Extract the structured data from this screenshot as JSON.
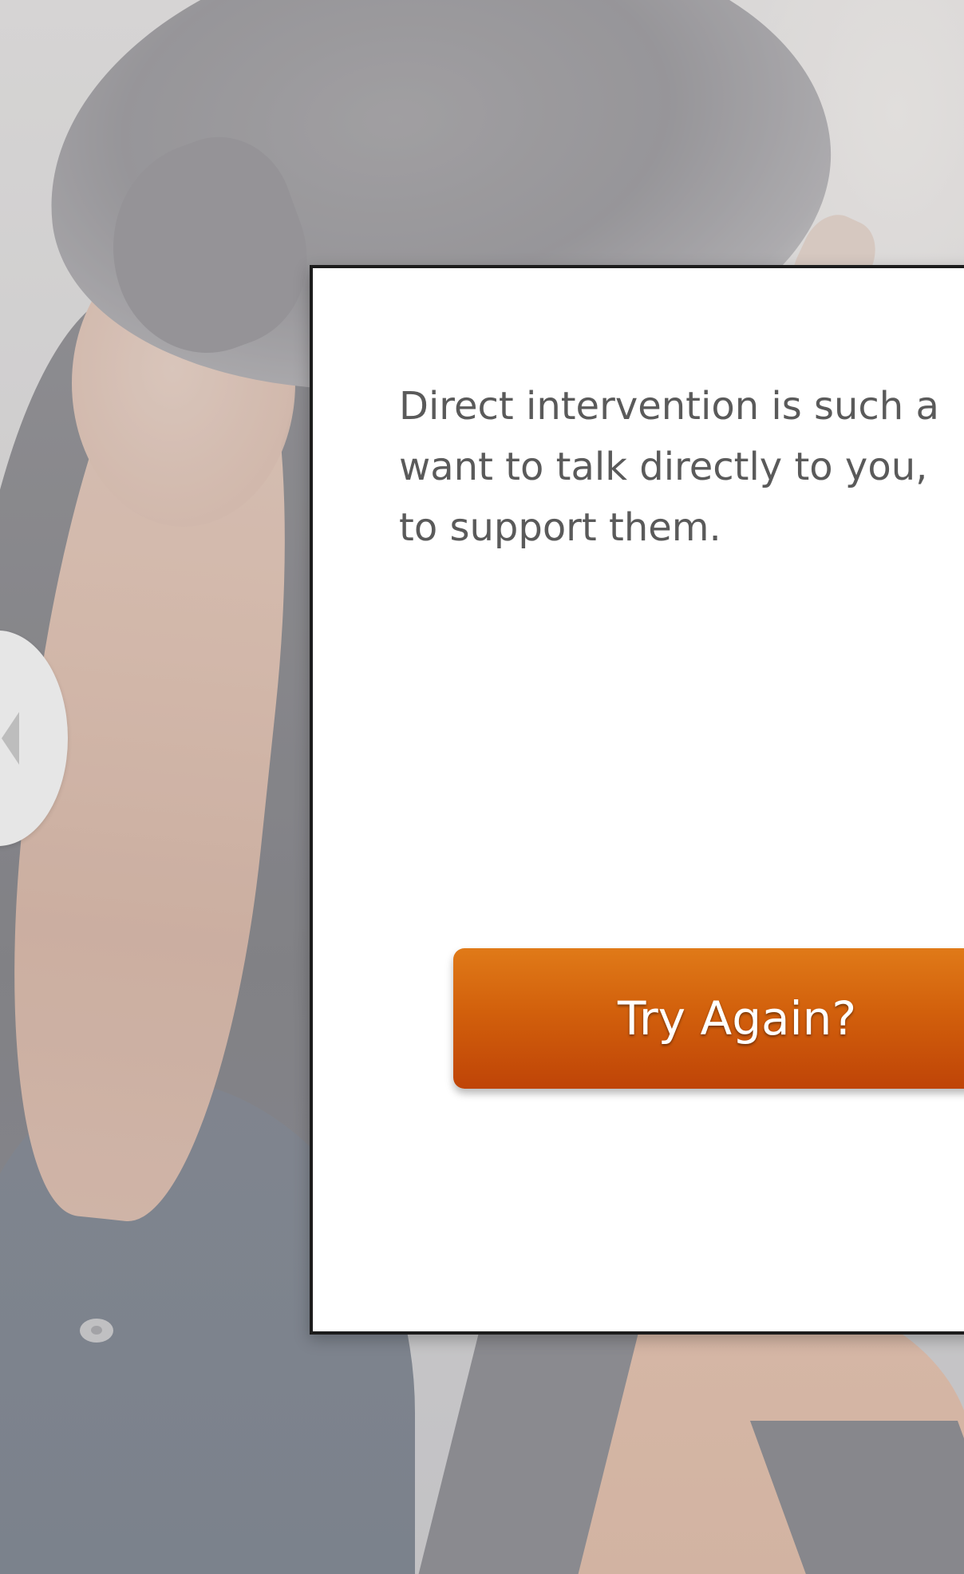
{
  "dialog": {
    "message": "Direct intervention is such a want to talk directly to you, to support them.",
    "lines": [
      "Direct intervention is such a",
      "want to talk directly to you,",
      "to support them."
    ],
    "retry_label": "Try Again?"
  },
  "navigation": {
    "back_icon": "chevron-left-icon"
  },
  "colors": {
    "button_top": "#e07a18",
    "button_bottom": "#bf4407",
    "dialog_border": "#1c1c1c",
    "text": "#5a5a5a"
  }
}
